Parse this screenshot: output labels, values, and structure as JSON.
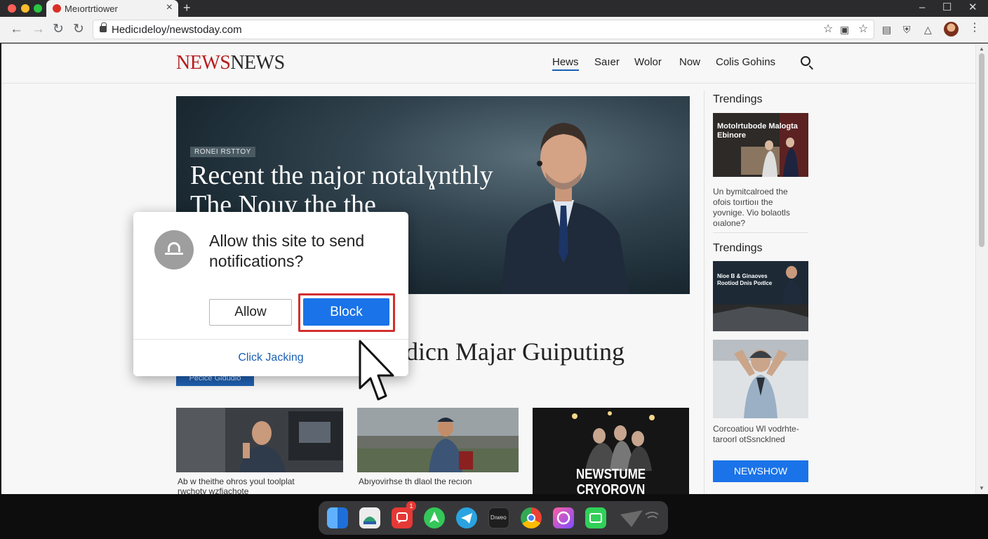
{
  "browser": {
    "tab_title": "Meıortrtiower",
    "url": "Hedicıdeloy/newstoday.com",
    "traffic_colors": {
      "close": "#ff5f57",
      "minimize": "#febc2e",
      "zoom": "#28c840"
    },
    "toolbar_icons": [
      "back-icon",
      "forward-icon",
      "reload-icon",
      "reload-icon",
      "lock-icon",
      "star-icon",
      "cast-icon",
      "bookmark-icon",
      "extension-icon",
      "shield-icon",
      "bell-icon",
      "avatar",
      "kebab-menu-icon"
    ]
  },
  "site": {
    "logo_part1": "NEWS",
    "logo_part2": "NEWS",
    "nav": [
      "Hews",
      "Saıer",
      "Wolor",
      "Now",
      "Colis Gohins"
    ],
    "active_nav_index": 0,
    "hero": {
      "tag": "RONEI RSTTOY",
      "headline_line1": "Recent the najor notalɣnthly",
      "headline_line2": "The Nouy the the"
    },
    "headline2": "dicn Majar Guiputing",
    "blue_label": "Pecice Gidudio",
    "cards": [
      {
        "caption_line1": "Ab w theithe ohros youl toolplat",
        "caption_line2": "rwchoty wzfiachote"
      },
      {
        "caption_line1": "Abıyovirhse th dlaol the recıon",
        "caption_line2": ""
      },
      {
        "overlay_line1": "NEWSTUME",
        "overlay_line2": "CRYOROVN"
      }
    ],
    "sidebar": {
      "heading1": "Trendings",
      "item1_image_text": "Motolrtubode Malogta Ebinore",
      "item1_caption": [
        "Un bymitcalroed the",
        "ofois toırtioıı the",
        "yovnige. Vio bolaotls",
        "oıalone?"
      ],
      "heading2": "Trendings",
      "item2_image_text": "Nioe B & Ginaoves Rootiod Dnis Poıtlce",
      "item3_caption": [
        "Corcoatiou Wl vodrhte-",
        "taroorl otSsncklned"
      ],
      "button": "NEWSHOW"
    }
  },
  "dialog": {
    "title": "Allow this site to send notifications?",
    "allow_label": "Allow",
    "block_label": "Block",
    "link_label": "Click Jacking",
    "icon": "bell-icon",
    "highlight_color": "#d32f2f",
    "primary_color": "#1a73e8"
  },
  "dock": {
    "apps": [
      {
        "name": "finder-icon",
        "color": "#2f88f0"
      },
      {
        "name": "photos-icon",
        "color": "#e8e8e8"
      },
      {
        "name": "messages-icon",
        "color": "#e53935"
      },
      {
        "name": "maps-icon",
        "color": "#34c759"
      },
      {
        "name": "telegram-icon",
        "color": "#2aa3e0"
      },
      {
        "name": "terminal-icon",
        "color": "#1e1e1e",
        "label": "Dıweo"
      },
      {
        "name": "chrome-icon",
        "color": "#fbbc05"
      },
      {
        "name": "music-icon",
        "color": "#a259ff"
      },
      {
        "name": "facetime-icon",
        "color": "#30d158"
      },
      {
        "name": "wifi-icon",
        "color": "#5a5a5a"
      }
    ],
    "messages_badge": "1"
  }
}
